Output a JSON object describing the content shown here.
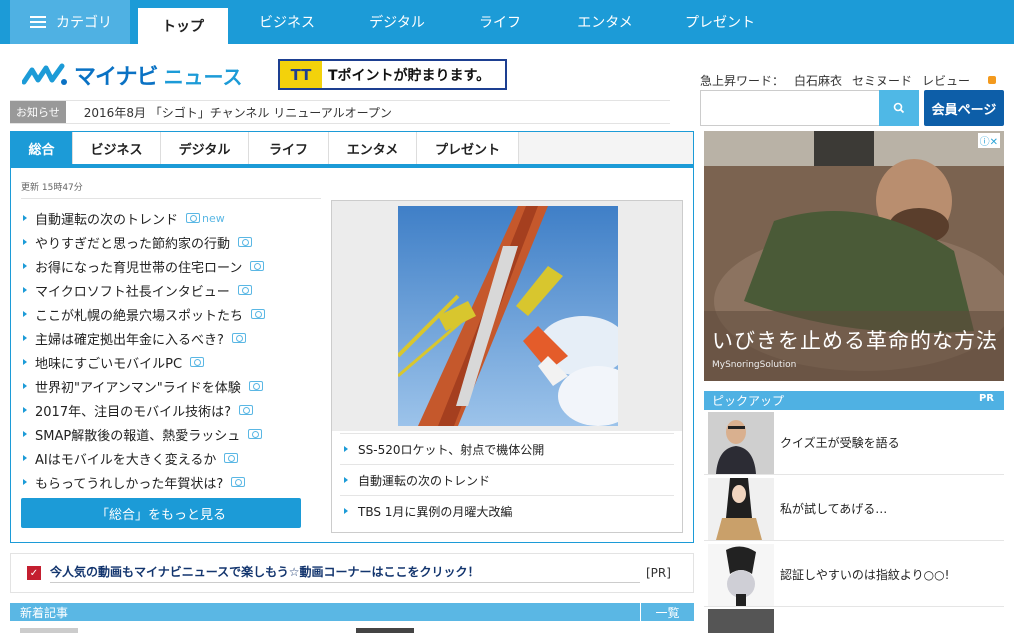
{
  "topnav": {
    "category_label": "カテゴリ",
    "tabs": [
      "トップ",
      "ビジネス",
      "デジタル",
      "ライフ",
      "エンタメ",
      "プレゼント"
    ]
  },
  "header": {
    "logo_text": "マイナビ",
    "logo_text2": "ニュース",
    "tpoint_logo": "TT",
    "tpoint_text": "Tポイントが貯まります。"
  },
  "trend": {
    "label": "急上昇ワード：",
    "words": [
      "白石麻衣",
      "セミヌード",
      "レビュー"
    ]
  },
  "notice": {
    "label": "お知らせ",
    "text": "2016年8月 「シゴト」チャンネル リニューアルオープン"
  },
  "search": {
    "placeholder": ""
  },
  "member_button": "会員ページ",
  "panel": {
    "tabs": [
      "総合",
      "ビジネス",
      "デジタル",
      "ライフ",
      "エンタメ",
      "プレゼント"
    ],
    "updated": "更新 15時47分",
    "new_tag": "new",
    "news": [
      "自動運転の次のトレンド",
      "やりすぎだと思った節約家の行動",
      "お得になった育児世帯の住宅ローン",
      "マイクロソフト社長インタビュー",
      "ここが札幌の絶景穴場スポットたち",
      "主婦は確定拠出年金に入るべき?",
      "地味にすごいモバイルPC",
      "世界初\"アイアンマン\"ライドを体験",
      "2017年、注目のモバイル技術は?",
      "SMAP解散後の報道、熱愛ラッシュ",
      "AIはモバイルを大きく変えるか",
      "もらってうれしかった年賀状は?"
    ],
    "more_button": "「総合」をもっと見る",
    "feature_links": [
      "SS-520ロケット、射点で機体公開",
      "自動運転の次のトレンド",
      "TBS 1月に異例の月曜大改編"
    ]
  },
  "prbar": {
    "text": "今人気の動画もマイナビニュースで楽しもう☆動画コーナーはここをクリック！",
    "pr": "[PR]"
  },
  "newbar": {
    "label": "新着記事",
    "all": "一覧"
  },
  "ad": {
    "headline": "いびきを止める革命的な方法",
    "brand": "MySnoringSolution"
  },
  "pickup": {
    "label": "ピックアップ",
    "pr": "PR",
    "items": [
      "クイズ王が受験を語る",
      "私が試してあげる…",
      "認証しやすいのは指紋より○○!"
    ]
  },
  "colors": {
    "nav": "#1c9bd7",
    "accent": "#4fb1e3",
    "member": "#0d5ea8"
  }
}
